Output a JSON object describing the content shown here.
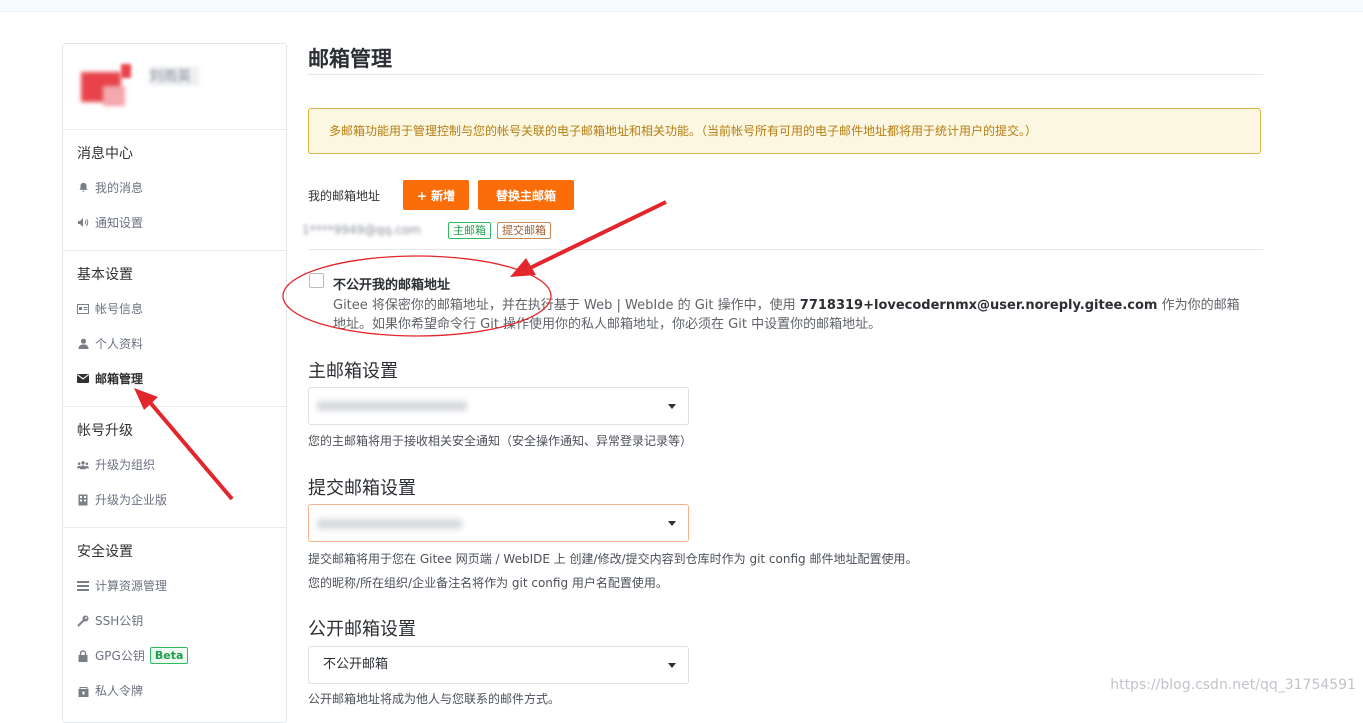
{
  "sidebar": {
    "user_name": "刘雨英",
    "sections": [
      {
        "title": "消息中心",
        "items": [
          {
            "label": "我的消息",
            "icon": "bell-icon"
          },
          {
            "label": "通知设置",
            "icon": "volume-icon"
          }
        ]
      },
      {
        "title": "基本设置",
        "items": [
          {
            "label": "帐号信息",
            "icon": "id-card-icon"
          },
          {
            "label": "个人资料",
            "icon": "user-icon"
          },
          {
            "label": "邮箱管理",
            "icon": "envelope-icon",
            "active": true
          }
        ]
      },
      {
        "title": "帐号升级",
        "items": [
          {
            "label": "升级为组织",
            "icon": "users-icon"
          },
          {
            "label": "升级为企业版",
            "icon": "building-icon"
          }
        ]
      },
      {
        "title": "安全设置",
        "items": [
          {
            "label": "计算资源管理",
            "icon": "list-icon"
          },
          {
            "label": "SSH公钥",
            "icon": "key-icon"
          },
          {
            "label": "GPG公钥",
            "icon": "lock-icon",
            "badge": "Beta"
          },
          {
            "label": "私人令牌",
            "icon": "token-icon"
          }
        ]
      }
    ]
  },
  "main": {
    "title": "邮箱管理",
    "notice": "多邮箱功能用于管理控制与您的帐号关联的电子邮箱地址和相关功能。（当前帐号所有可用的电子邮件地址都将用于统计用户的提交。）",
    "my_email_label": "我的邮箱地址",
    "add_button": "+ 新增",
    "replace_button": "替换主邮箱",
    "email_address": "1****9949@qq.com",
    "tag_primary": "主邮箱",
    "tag_commit": "提交邮箱",
    "private_checkbox_label": "不公开我的邮箱地址",
    "private_desc_before": "Gitee 将保密你的邮箱地址，并在执行基于 Web | WebIde 的 Git 操作中，使用 ",
    "private_desc_email": "7718319+lovecodernmx@user.noreply.gitee.com",
    "private_desc_after": " 作为你的邮箱地址。如果你希望命令行 Git 操作使用你的私人邮箱地址，你必须在 Git 中设置你的邮箱地址。",
    "primary_title": "主邮箱设置",
    "primary_help": "您的主邮箱将用于接收相关安全通知（安全操作通知、异常登录记录等）",
    "commit_title": "提交邮箱设置",
    "commit_help_1": "提交邮箱将用于您在 Gitee 网页端 / WebIDE 上 创建/修改/提交内容到仓库时作为 git config 邮件地址配置使用。",
    "commit_help_2": "您的昵称/所在组织/企业备注名将作为 git config 用户名配置使用。",
    "public_title": "公开邮箱设置",
    "public_value": "不公开邮箱",
    "public_help": "公开邮箱地址将成为他人与您联系的邮件方式。"
  },
  "watermark": "https://blog.csdn.net/qq_31754591",
  "colors": {
    "accent": "#fb6d08",
    "annotation": "#e3262b"
  }
}
